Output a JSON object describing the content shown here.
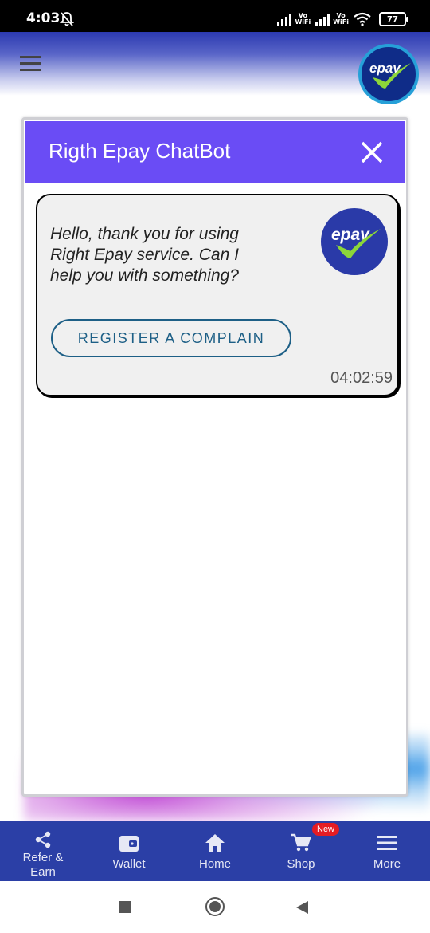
{
  "status_bar": {
    "time": "4:03",
    "vo_top": "Vo",
    "vo_bottom": "WiFi",
    "battery": "77",
    "icons": [
      "bell-off-icon",
      "signal-icon",
      "wifi-icon",
      "battery-icon"
    ]
  },
  "chatbot": {
    "title": "Rigth Epay ChatBot",
    "header_color": "#6a4cf5",
    "message": {
      "text": "Hello, thank you for using Right Epay service. Can I help you with something?",
      "button_label": "REGISTER A COMPLAIN",
      "time": "04:02:59"
    }
  },
  "bottom_nav": {
    "items": [
      {
        "label": "Refer & Earn",
        "icon": "share-icon"
      },
      {
        "label": "Wallet",
        "icon": "wallet-icon"
      },
      {
        "label": "Home",
        "icon": "home-icon"
      },
      {
        "label": "Shop",
        "icon": "cart-icon",
        "badge": "New"
      },
      {
        "label": "More",
        "icon": "menu-icon"
      }
    ],
    "color": "#2b3fa6"
  }
}
